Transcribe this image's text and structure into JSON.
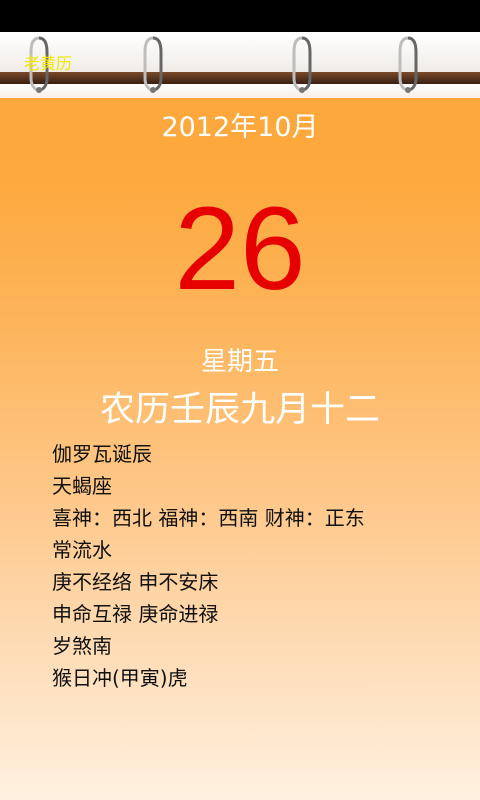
{
  "app": {
    "title": "老黄历"
  },
  "calendar": {
    "month_year": "2012年10月",
    "day": "26",
    "weekday": "星期五",
    "lunar_date": "农历壬辰九月十二"
  },
  "details": [
    "伽罗瓦诞辰",
    "天蝎座",
    "喜神：西北 福神：西南 财神：正东",
    "常流水",
    "庚不经络 申不安床",
    "申命互禄 庚命进禄",
    "岁煞南",
    "猴日冲(甲寅)虎"
  ],
  "colors": {
    "day_number": "#e60000",
    "title": "#f1e700",
    "background_top": "#fda63a",
    "background_bottom": "#fff1e0"
  }
}
